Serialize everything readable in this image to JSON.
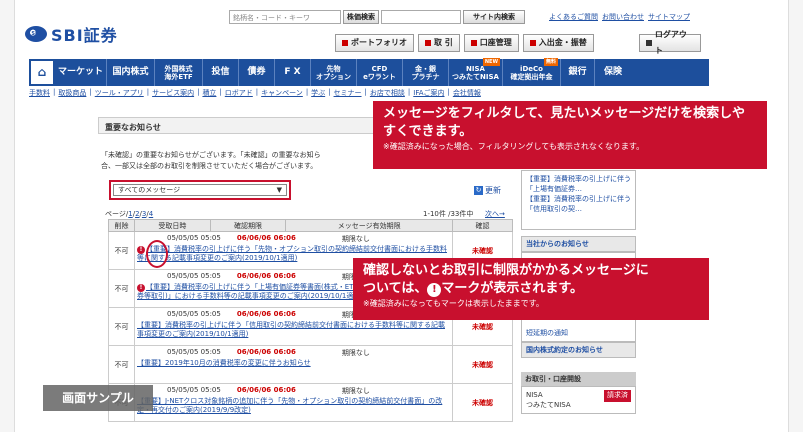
{
  "header": {
    "logo_mark": "SBI",
    "logo_text": "SBI証券",
    "search_placeholder": "銘柄名・コード・キーワ",
    "stock_search_btn": "株価検索",
    "site_search_btn": "サイト内検索",
    "top_links": [
      "よくあるご質問",
      "お問い合わせ",
      "サイトマップ"
    ],
    "account_buttons": [
      "ポートフォリオ",
      "取 引",
      "口座管理",
      "入出金・振替"
    ],
    "logout": "ログアウト"
  },
  "nav": {
    "home_icon": "home-icon",
    "items": [
      {
        "label": "マーケット"
      },
      {
        "label": "国内株式"
      },
      {
        "label": "外国株式\n海外ETF"
      },
      {
        "label": "投信"
      },
      {
        "label": "債券"
      },
      {
        "label": "F X"
      },
      {
        "label": "先物\nオプション"
      },
      {
        "label": "CFD\neワラント"
      },
      {
        "label": "金・銀\nプラチナ"
      },
      {
        "label": "NISA\nつみたてNISA",
        "badge": "NEW"
      },
      {
        "label": "iDeCo\n確定拠出年金",
        "badge": "無料"
      },
      {
        "label": "銀行"
      },
      {
        "label": "保険"
      }
    ]
  },
  "subnav": [
    "手数料",
    "取扱商品",
    "ツール・アプリ",
    "サービス案内",
    "積立",
    "ロボアド",
    "キャンペーン",
    "学ぶ",
    "セミナー",
    "お店で相談",
    "IFAご案内",
    "会社情報"
  ],
  "main": {
    "title": "重要なお知らせ",
    "notice_lines": [
      "「未確認」の重要なお知らせがございます。「未確認」の重要なお知ら",
      "合、一部又は全部のお取引を制限させていただく場合がございます。"
    ],
    "filter_value": "すべてのメッセージ",
    "refresh": "更新",
    "pager_prefix": "ページ",
    "pager_pages": [
      "1",
      "2",
      "3",
      "4"
    ],
    "count": "1-10件 /33件中",
    "next": "次へ→",
    "columns": [
      "削除",
      "受取日時",
      "確認期限",
      "メッセージ有効期限",
      "確認"
    ],
    "rows": [
      {
        "del": "不可",
        "received": "05/05/05 05:05",
        "deadline": "06/06/06 06:06",
        "expiry": "期限なし",
        "subject": "【重要】消費税率の引上げに伴う「先物・オプション取引の契約締結前交付書面における手数料等に関する記載事項変更のご案内(2019/10/1適用)",
        "status": "未確認",
        "alert": true
      },
      {
        "del": "不可",
        "received": "05/05/05 05:05",
        "deadline": "06/06/06 06:06",
        "expiry": "期限なし",
        "subject": "【重要】消費税率の引上げに伴う「上場有価証券等書面(株式・ETF・REIT・その他上場有価証券等取引)」における手数料等の記載事項変更のご案内(2019/10/1適用)",
        "status": "未確認",
        "alert": true
      },
      {
        "del": "不可",
        "received": "05/05/05 05:05",
        "deadline": "06/06/06 06:06",
        "expiry": "期限なし",
        "subject": "【重要】消費税率の引上げに伴う「信用取引の契約締結前交付書面における手数料等に関する記載事項変更のご案内(2019/10/1適用)",
        "status": "未確認",
        "alert": false
      },
      {
        "del": "不可",
        "received": "05/05/05 05:05",
        "deadline": "06/06/06 06:06",
        "expiry": "期限なし",
        "subject": "【重要】2019年10月の消費税率の変更に伴うお知らせ",
        "status": "未確認",
        "alert": false
      },
      {
        "del": "不可",
        "received": "05/05/05 05:05",
        "deadline": "06/06/06 06:06",
        "expiry": "期限なし",
        "subject": "【重要】J-NETクロス対象銘柄の追加に伴う「先物・オプション取引の契約締結前交付書面」の改定・再交付のご案内(2019/9/9改定)",
        "status": "未確認",
        "alert": false
      }
    ]
  },
  "sidebar": {
    "links": [
      "【重要】消費税率の引上げに伴う「上場有価証券…",
      "【重要】消費税率の引上げに伴う「信用取引の契…"
    ],
    "section1": "当社からのお知らせ",
    "frag1": "短延期の通知",
    "section2": "国内株式約定のお知らせ",
    "section3": "お取引・口座開設",
    "nisa": "NISA\nつみたてNISA",
    "request": "請求済"
  },
  "callouts": {
    "top_big": "メッセージをフィルタして、見たいメッセージだけを検索しやすくできます。",
    "top_small": "※確認済みになった場合、フィルタリングしても表示されなくなります。",
    "bottom_big_1": "確認しないとお取引に制限がかかるメッセージに",
    "bottom_big_2a": "ついては、",
    "bottom_big_2b": "マークが表示されます。",
    "bottom_small": "※確認済みになってもマークは表示したままです。"
  },
  "sample_label": "画面サンプル"
}
